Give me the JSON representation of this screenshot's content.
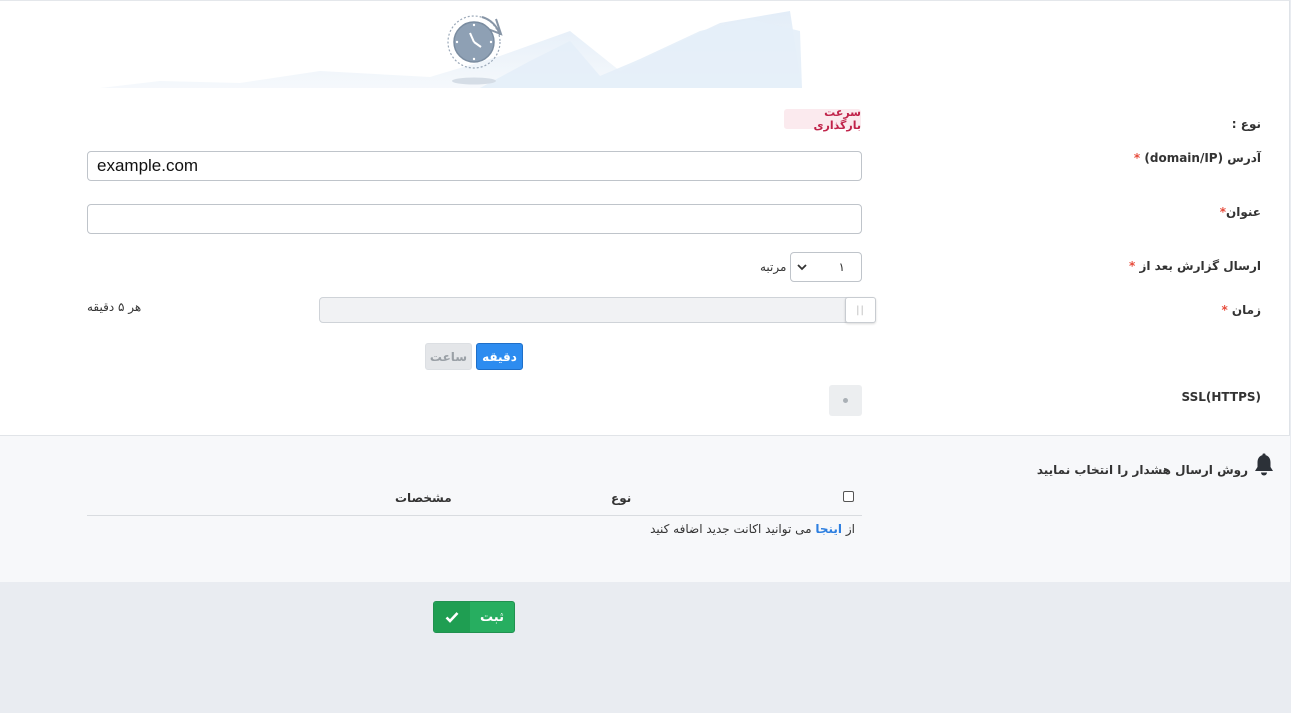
{
  "form": {
    "type_label": "نوع :",
    "type_value": "سرعت بارگذاری",
    "address_label": "آدرس (domain/IP)",
    "address_value": "example.com",
    "title_label": "عنوان",
    "title_value": "",
    "report_after_label": "ارسال گزارش بعد از",
    "report_after_value": "۱",
    "report_after_unit": "مرتبه",
    "time_label": "زمان",
    "time_readout": "هر ۵ دقیقه",
    "unit_minute": "دقیقه",
    "unit_hour": "ساعت",
    "ssl_label": "SSL(HTTPS)",
    "required_mark": "*"
  },
  "alerts": {
    "heading": "روش ارسال هشدار را انتخاب نمایید",
    "col_type": "نوع",
    "col_details": "مشخصات",
    "add_prefix": "از",
    "add_link": "اینجا",
    "add_suffix": "می توانید اکانت جدید اضافه کنید"
  },
  "actions": {
    "submit_label": "ثبت"
  },
  "icons": {
    "banner": "clock-refresh-icon",
    "bell": "bell-icon",
    "submit": "check-icon",
    "select": "chevron-down-icon",
    "slider": "grip-icon"
  },
  "colors": {
    "primary": "#2d8cf0",
    "success": "#27ae60",
    "required": "#e74c3c",
    "badge_text": "#c0234a",
    "badge_bg": "#fbeaee"
  }
}
